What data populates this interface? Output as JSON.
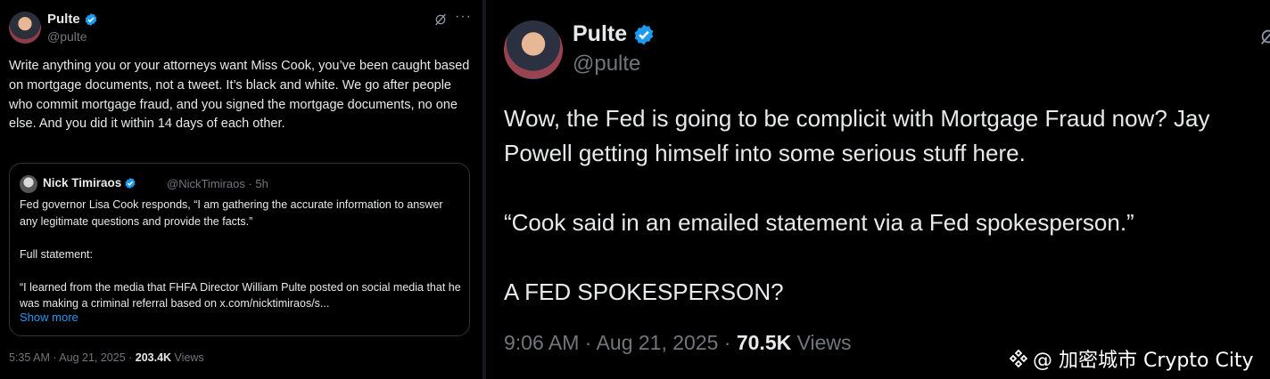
{
  "left_tweet": {
    "author": {
      "name": "Pulte",
      "handle": "@pulte"
    },
    "text": "Write anything you or your attorneys want Miss Cook, you’ve been caught based on mortgage documents, not a tweet. It’s black and white. We go after people who commit mortgage fraud, and you signed the mortgage documents, no one else. And you did it within 14 days of each other.",
    "quoted": {
      "author": {
        "name": "Nick Timiraos"
      },
      "meta": "@NickTimiraos · 5h",
      "paragraphs": [
        "Fed governor Lisa Cook responds, “I am gathering the accurate information to answer any legitimate questions and provide the facts.”",
        "Full statement:",
        "“I learned from the media that FHFA Director William Pulte posted on social media that he was making a criminal referral based on x.com/nicktimiraos/s..."
      ],
      "show_more": "Show more"
    },
    "footer": {
      "time": "5:35 AM · Aug 21, 2025 · ",
      "views_count": "203.4K",
      "views_label": " Views"
    }
  },
  "right_tweet": {
    "author": {
      "name": "Pulte",
      "handle": "@pulte"
    },
    "paragraphs": [
      "Wow, the Fed is going to be complicit with Mortgage Fraud now? Jay Powell getting himself into some serious stuff here.",
      "“Cook said in an emailed statement via a Fed spokesperson.”",
      "A FED SPOKESPERSON?"
    ],
    "footer": {
      "time": "9:06 AM · Aug 21, 2025 · ",
      "views_count": "70.5K",
      "views_label": " Views"
    }
  },
  "watermark": {
    "text": "@ 加密城市 Crypto City",
    "logo_icon": "binance-square-icon"
  },
  "colors": {
    "background": "#000000",
    "text": "#e7e9ea",
    "muted": "#71767b",
    "link": "#1d9bf0",
    "verified": "#1d9bf0",
    "border": "#2f3336"
  }
}
